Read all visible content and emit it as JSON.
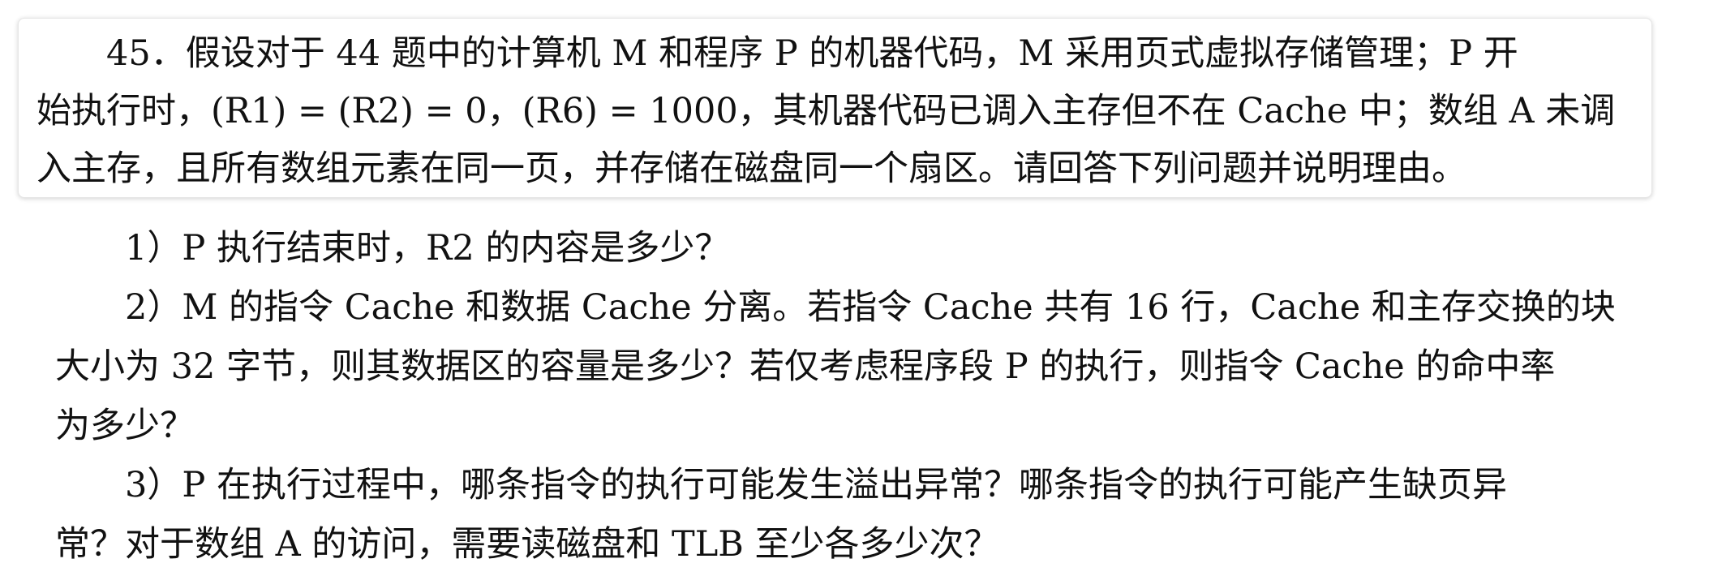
{
  "question": {
    "lines": [
      "　　45．假设对于 44 题中的计算机 M 和程序 P 的机器代码，M 采用页式虚拟存储管理；P 开",
      "始执行时，(R1) = (R2) = 0，(R6) = 1000，其机器代码已调入主存但不在 Cache 中；数组 A 未调",
      "入主存，且所有数组元素在同一页，并存储在磁盘同一个扇区。请回答下列问题并说明理由。"
    ]
  },
  "subquestions": [
    {
      "lines": [
        "　　1）P 执行结束时，R2 的内容是多少？"
      ]
    },
    {
      "lines": [
        "　　2）M 的指令 Cache 和数据 Cache 分离。若指令 Cache 共有 16 行，Cache 和主存交换的块",
        "大小为 32 字节，则其数据区的容量是多少？若仅考虑程序段 P 的执行，则指令 Cache 的命中率",
        "为多少？"
      ]
    },
    {
      "lines": [
        "　　3）P 在执行过程中，哪条指令的执行可能发生溢出异常？哪条指令的执行可能产生缺页异",
        "常？对于数组 A 的访问，需要读磁盘和 TLB 至少各多少次？"
      ]
    }
  ]
}
